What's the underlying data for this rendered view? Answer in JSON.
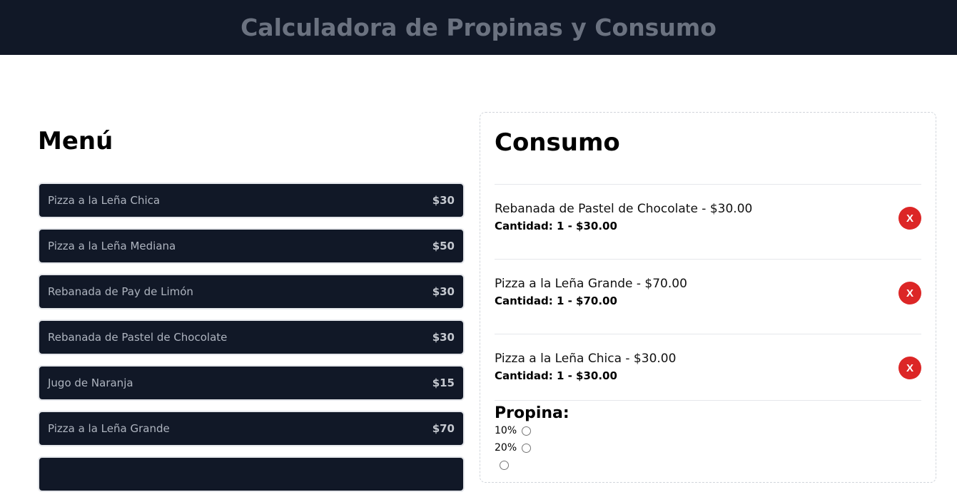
{
  "header": {
    "title": "Calculadora de Propinas y Consumo"
  },
  "menu": {
    "heading": "Menú",
    "items": [
      {
        "name": "Pizza a la Leña Chica",
        "price": "$30"
      },
      {
        "name": "Pizza a la Leña Mediana",
        "price": "$50"
      },
      {
        "name": "Rebanada de Pay de Limón",
        "price": "$30"
      },
      {
        "name": "Rebanada de Pastel de Chocolate",
        "price": "$30"
      },
      {
        "name": "Jugo de Naranja",
        "price": "$15"
      },
      {
        "name": "Pizza a la Leña Grande",
        "price": "$70"
      },
      {
        "name": "",
        "price": ""
      }
    ]
  },
  "consumo": {
    "heading": "Consumo",
    "orders": [
      {
        "title": "Rebanada de Pastel de Chocolate - $30.00",
        "qty": "Cantidad: 1 - $30.00",
        "delete_label": "X"
      },
      {
        "title": "Pizza a la Leña Grande - $70.00",
        "qty": "Cantidad: 1 - $70.00",
        "delete_label": "X"
      },
      {
        "title": "Pizza a la Leña Chica - $30.00",
        "qty": "Cantidad: 1 - $30.00",
        "delete_label": "X"
      }
    ],
    "propina": {
      "heading": "Propina:",
      "options": [
        "10%",
        "20%",
        ""
      ]
    }
  },
  "colors": {
    "header_bg": "#111827",
    "item_bg": "#111827",
    "delete": "#dc2626"
  }
}
